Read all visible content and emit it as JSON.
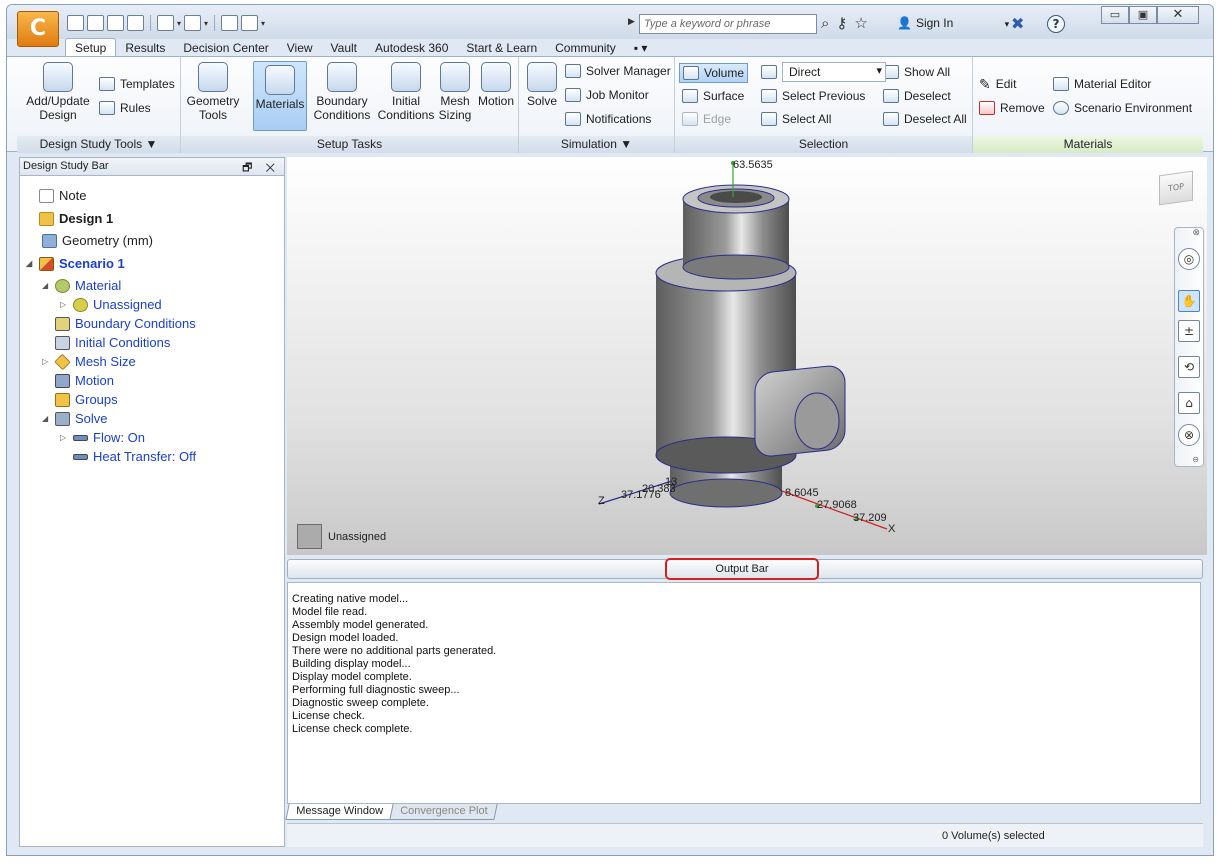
{
  "title_bar": {
    "logo_letter": "C",
    "search_placeholder": "Type a keyword or phrase",
    "sign_in": "Sign In",
    "help": "?",
    "window_controls": {
      "minimize": "▭",
      "restore": "▣",
      "close": "✕"
    }
  },
  "menu_tabs": [
    {
      "label": "Setup",
      "active": true
    },
    {
      "label": "Results"
    },
    {
      "label": "Decision Center"
    },
    {
      "label": "View"
    },
    {
      "label": "Vault"
    },
    {
      "label": "Autodesk 360"
    },
    {
      "label": "Start & Learn"
    },
    {
      "label": "Community"
    },
    {
      "label": "▪ ▾"
    }
  ],
  "ribbon": {
    "design_study_tools": {
      "label": "Design Study Tools ▼",
      "add_update": "Add/Update Design",
      "templates": "Templates",
      "rules": "Rules"
    },
    "setup_tasks": {
      "label": "Setup Tasks",
      "geometry_tools": "Geometry Tools",
      "materials": "Materials",
      "boundary_conditions": "Boundary Conditions",
      "initial_conditions": "Initial Conditions",
      "mesh_sizing": "Mesh Sizing",
      "motion": "Motion"
    },
    "simulation": {
      "label": "Simulation ▼",
      "solve": "Solve",
      "solver_manager": "Solver Manager",
      "job_monitor": "Job Monitor",
      "notifications": "Notifications"
    },
    "selection": {
      "label": "Selection",
      "volume": "Volume",
      "surface": "Surface",
      "edge": "Edge",
      "direct": "Direct",
      "select_previous": "Select Previous",
      "select_all": "Select All",
      "show_all": "Show All",
      "deselect": "Deselect",
      "deselect_all": "Deselect All"
    },
    "materials": {
      "label": "Materials",
      "edit": "Edit",
      "remove": "Remove",
      "material_editor": "Material Editor",
      "scenario_environment": "Scenario Environment"
    }
  },
  "design_study_bar": {
    "title": "Design Study Bar",
    "controls": "🗗 ✕",
    "tree": {
      "note": "Note",
      "design": "Design 1",
      "geometry": "Geometry (mm)",
      "scenario": "Scenario 1",
      "material": "Material",
      "unassigned": "Unassigned",
      "boundary_conditions": "Boundary Conditions",
      "initial_conditions": "Initial Conditions",
      "mesh_size": "Mesh Size",
      "motion": "Motion",
      "groups": "Groups",
      "solve": "Solve",
      "flow": "Flow: On",
      "heat_transfer": "Heat Transfer: Off"
    }
  },
  "viewport": {
    "legend_label": "Unassigned",
    "viewcube_label": "TOP",
    "axis_labels": {
      "y_top": "63.5635",
      "z_1": "37.1776",
      "z_2": "20.383",
      "z_3": "13",
      "x_1": "8.6045",
      "x_2": "27.9068",
      "x_3": "37.209",
      "x_axis": "X",
      "z_axis": "Z"
    }
  },
  "output_bar": {
    "label": "Output Bar"
  },
  "message_window": {
    "lines": [
      "Creating native model...",
      "Model file read.",
      "Assembly model generated.",
      "Design model loaded.",
      "There were no additional parts generated.",
      "Building display model...",
      "Display model complete.",
      "Performing full diagnostic sweep...",
      "Diagnostic sweep complete.",
      "License check.",
      "License check complete."
    ]
  },
  "bottom_tabs": {
    "message_window": "Message Window",
    "convergence_plot": "Convergence Plot"
  },
  "status_bar": {
    "selection_status": "0 Volume(s) selected"
  },
  "colors": {
    "accent": "#e07b10",
    "tree_link": "#1a3fd0",
    "highlight": "#d62020"
  }
}
